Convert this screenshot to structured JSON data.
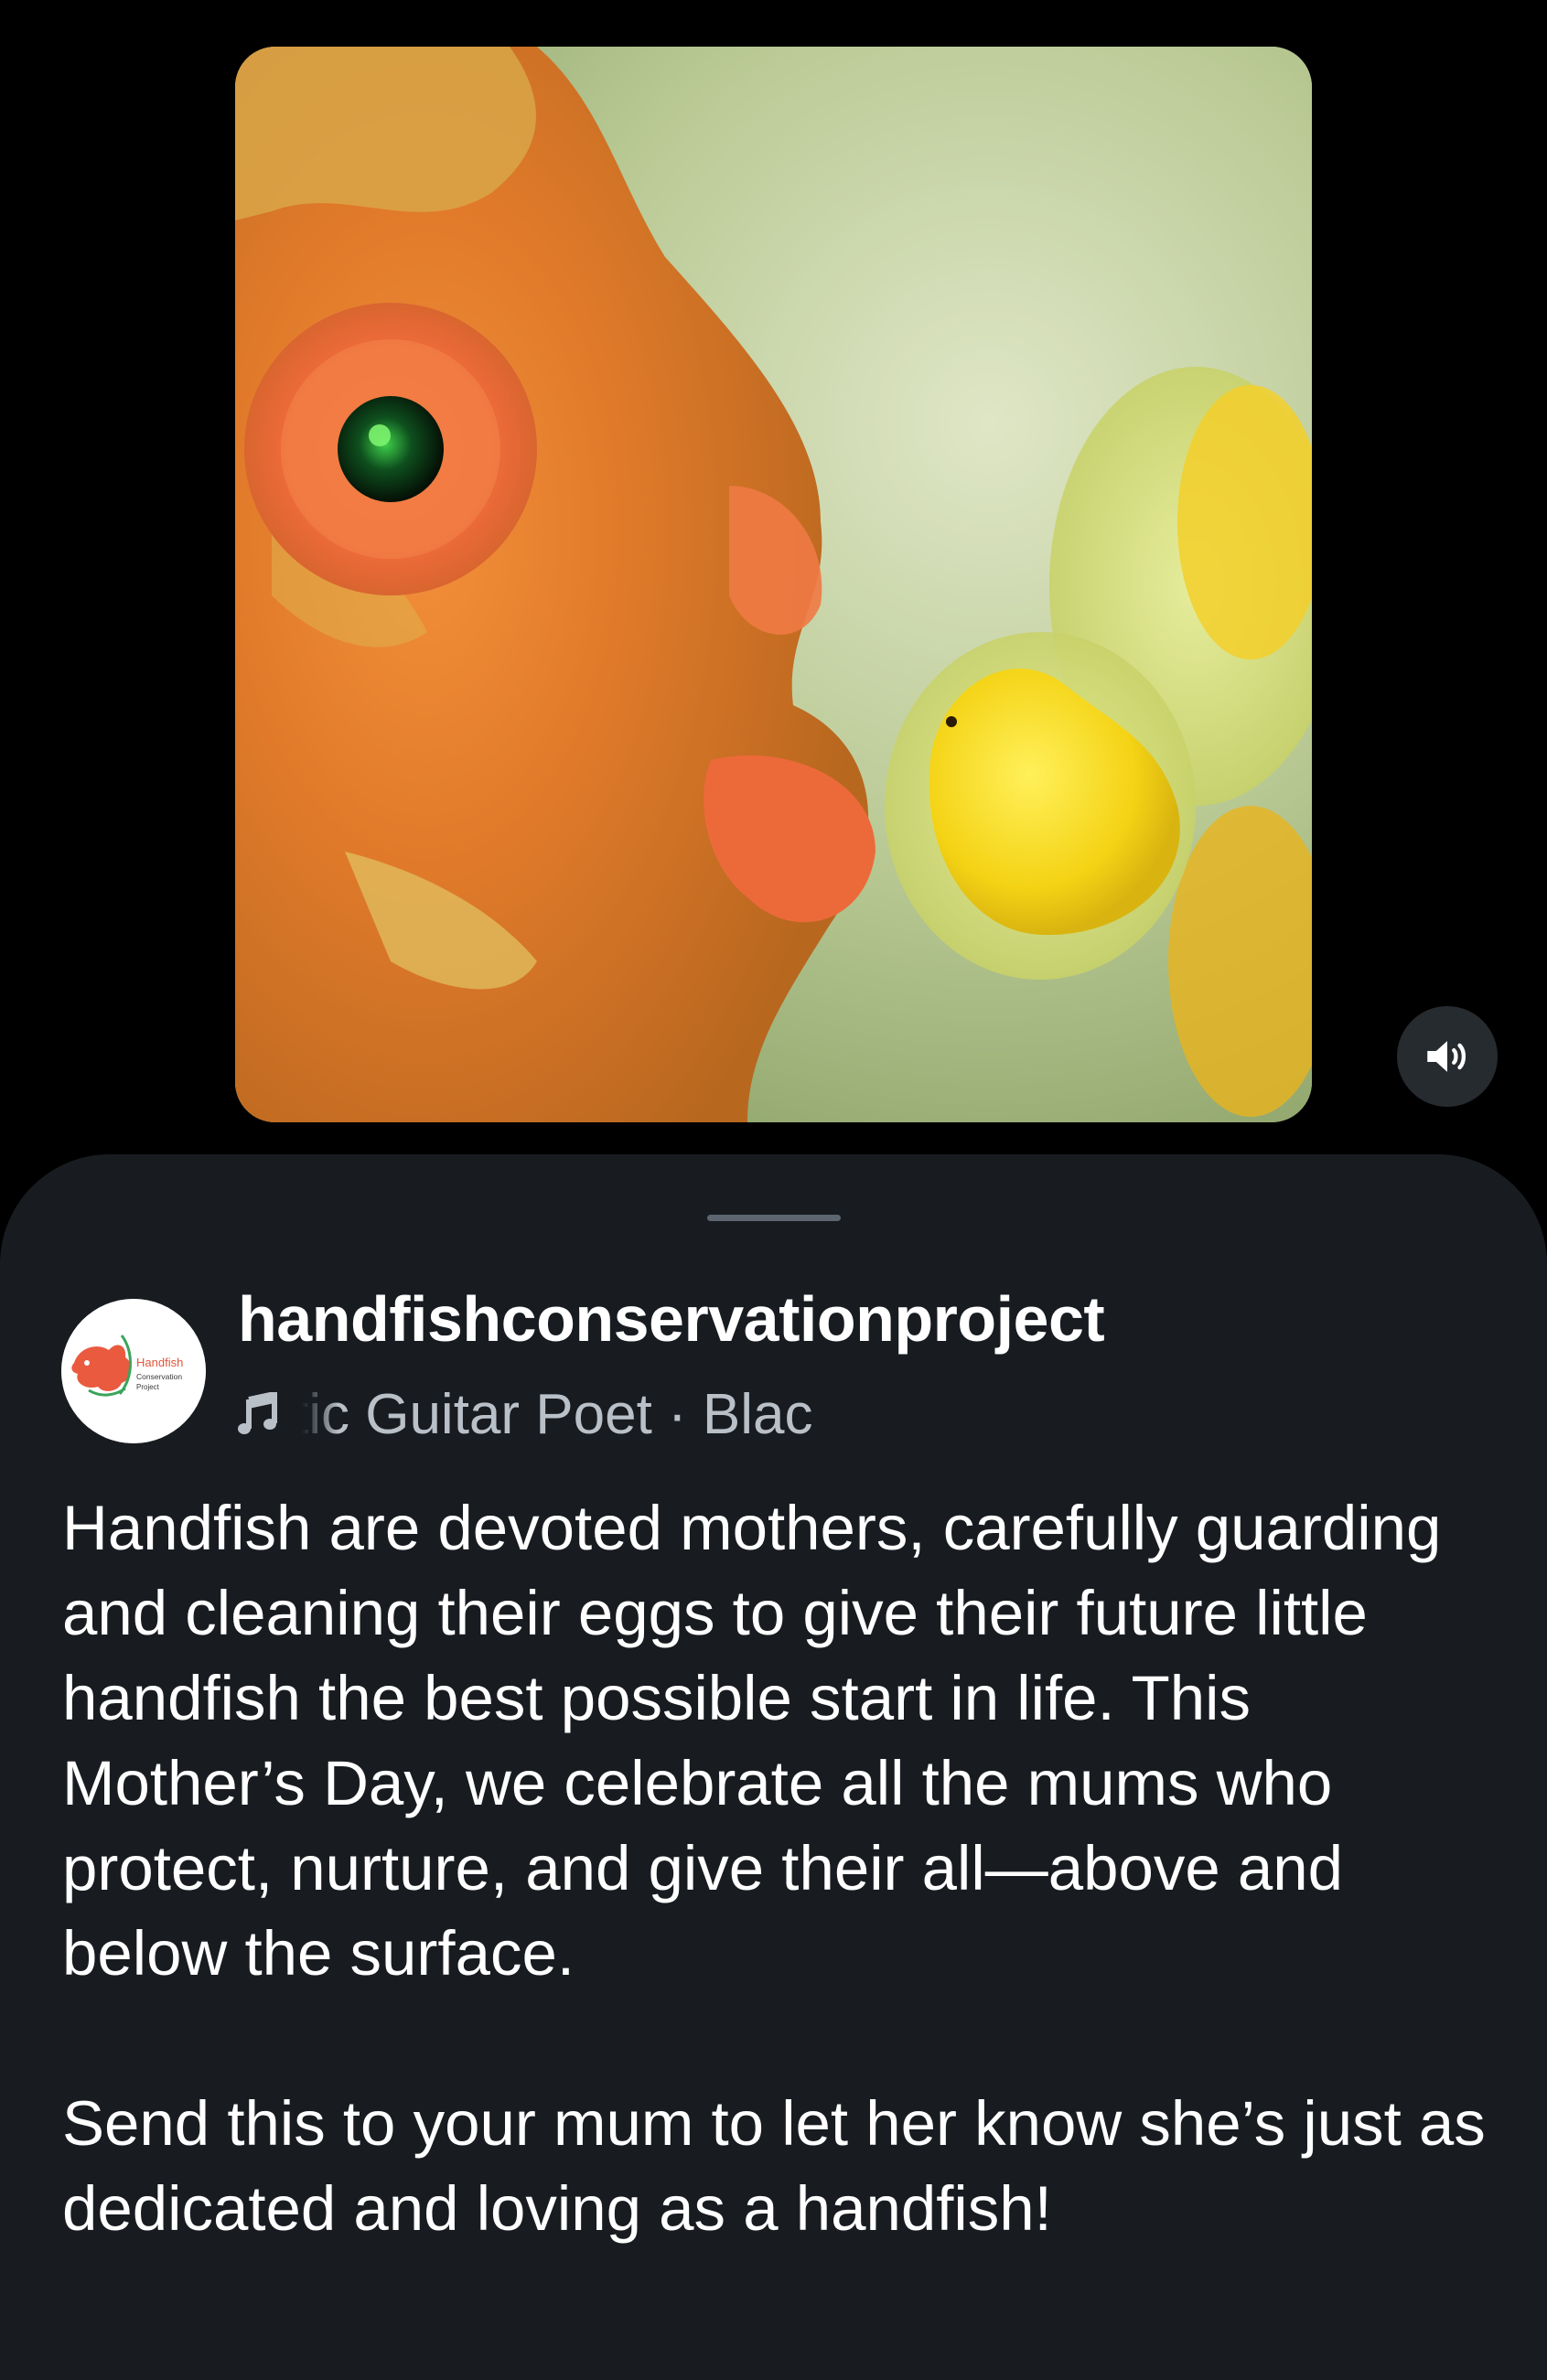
{
  "media": {
    "controls": {
      "mute_icon": "speaker-volume-icon"
    }
  },
  "post": {
    "account": {
      "username": "handfishconservationproject",
      "avatar_logo_text": [
        "Handfish",
        "Conservation",
        "Project"
      ]
    },
    "audio": {
      "icon": "music-note-icon",
      "track_text": "tic Guitar Poet · Blac"
    },
    "caption": {
      "paragraph_1": "Handfish are devoted mothers, carefully guarding and cleaning their eggs to give their future little handfish the best possible start in life. This Mother’s Day, we celebrate all the mums who protect, nurture, and give their all—above and below the surface.",
      "paragraph_2": "Send this to your mum to let her know she’s just as dedicated and loving as a handfish!"
    }
  },
  "colors": {
    "background": "#000000",
    "sheet": "#181c21",
    "secondary_text": "#b9c0c7",
    "handle": "#5d6670",
    "mute_button": "#262b30"
  }
}
